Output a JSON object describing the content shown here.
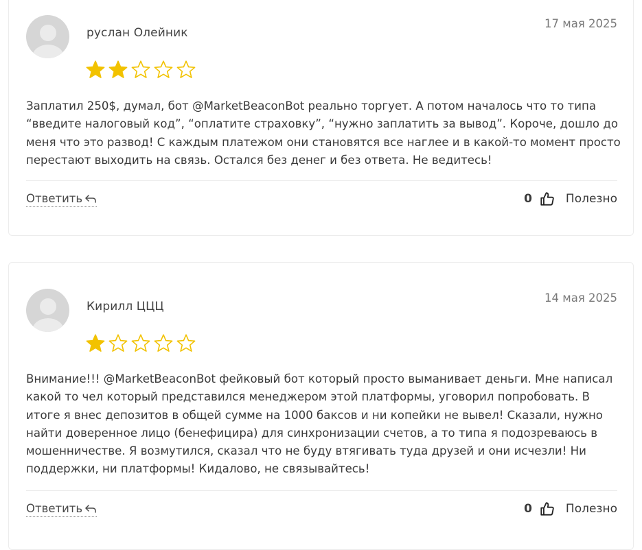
{
  "colors": {
    "star": "#f2c200",
    "star_empty_stroke": "#f2c200",
    "card_border": "#ececec",
    "text": "#3a3a3a"
  },
  "reviews": [
    {
      "author": "руслан Олейник",
      "date": "17 мая 2025",
      "rating": 2,
      "max_rating": 5,
      "text": "Заплатил 250$, думал, бот @MarketBeaconBot реально торгует. А потом началось что то типа “введите налоговый код”, “оплатите страховку”, “нужно заплатить за вывод”. Короче, дошло до меня что это развод! С каждым платежом они становятся все наглее и в какой-то момент просто перестают выходить на связь. Остался без денег и без ответа. Не ведитесь!",
      "reply_label": "Ответить",
      "useful_count": "0",
      "useful_label": "Полезно"
    },
    {
      "author": "Кирилл ЦЦЦ",
      "date": "14 мая 2025",
      "rating": 1,
      "max_rating": 5,
      "text": "Внимание!!! @MarketBeaconBot фейковый бот который просто выманивает деньги. Мне написал какой то чел который представился менеджером этой платформы, уговорил попробовать. В итоге я внес депозитов в общей сумме на 1000 баксов и ни копейки не вывел! Сказали, нужно найти доверенное лицо (бенефицира) для синхронизации счетов, а то типа я подозреваюсь в мошенничестве. Я возмутился, сказал что не буду втягивать туда друзей и они исчезли! Ни поддержки, ни платформы! Кидалово, не связывайтесь!",
      "reply_label": "Ответить",
      "useful_count": "0",
      "useful_label": "Полезно"
    }
  ]
}
